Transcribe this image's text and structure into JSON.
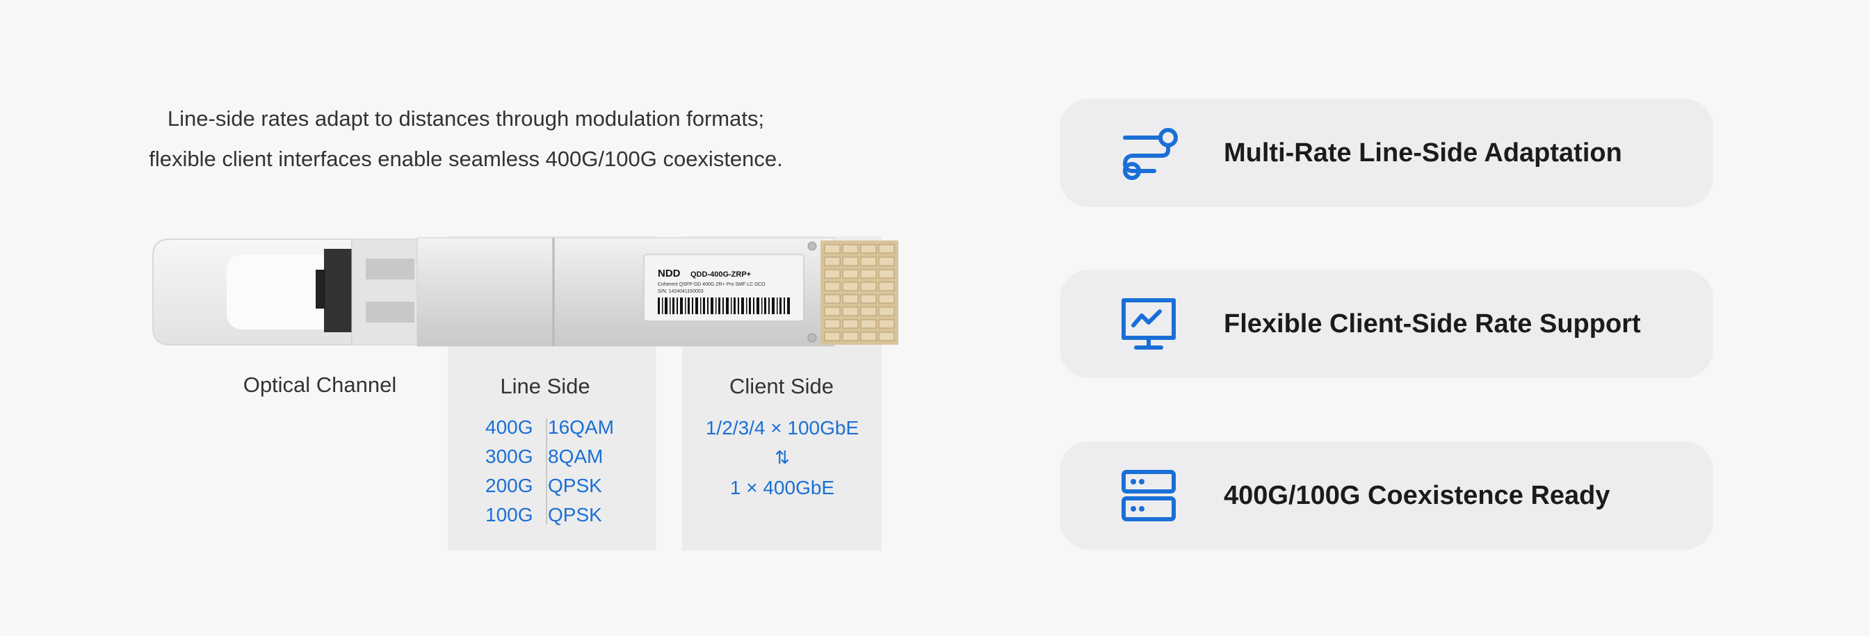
{
  "intro": {
    "line1": "Line-side rates adapt to distances through modulation formats;",
    "line2": "flexible client interfaces enable seamless 400G/100G coexistence."
  },
  "module": {
    "label_brand": "NDD",
    "label_model": "QDD-400G-ZRP+",
    "label_desc": "Coherent QSFP-DD 400G ZR+ Pro SMF LC DCO",
    "label_sn": "S/N: 1424041150003"
  },
  "labels": {
    "optical_channel": "Optical Channel",
    "line_side": "Line Side",
    "client_side": "Client Side"
  },
  "line_side_rates": [
    {
      "rate": "400G",
      "mod": "16QAM"
    },
    {
      "rate": "300G",
      "mod": "8QAM"
    },
    {
      "rate": "200G",
      "mod": "QPSK"
    },
    {
      "rate": "100G",
      "mod": "QPSK"
    }
  ],
  "client_side": {
    "top": "1/2/3/4 × 100GbE",
    "swap": "⇅",
    "bottom": "1 × 400GbE"
  },
  "features": [
    {
      "title": "Multi-Rate Line-Side Adaptation",
      "icon": "route-icon"
    },
    {
      "title": "Flexible Client-Side Rate Support",
      "icon": "monitor-chart-icon"
    },
    {
      "title": "400G/100G Coexistence Ready",
      "icon": "server-icon"
    }
  ],
  "colors": {
    "accent": "#1a6fd6",
    "background": "#f7f7f7",
    "card": "#ededf0"
  }
}
